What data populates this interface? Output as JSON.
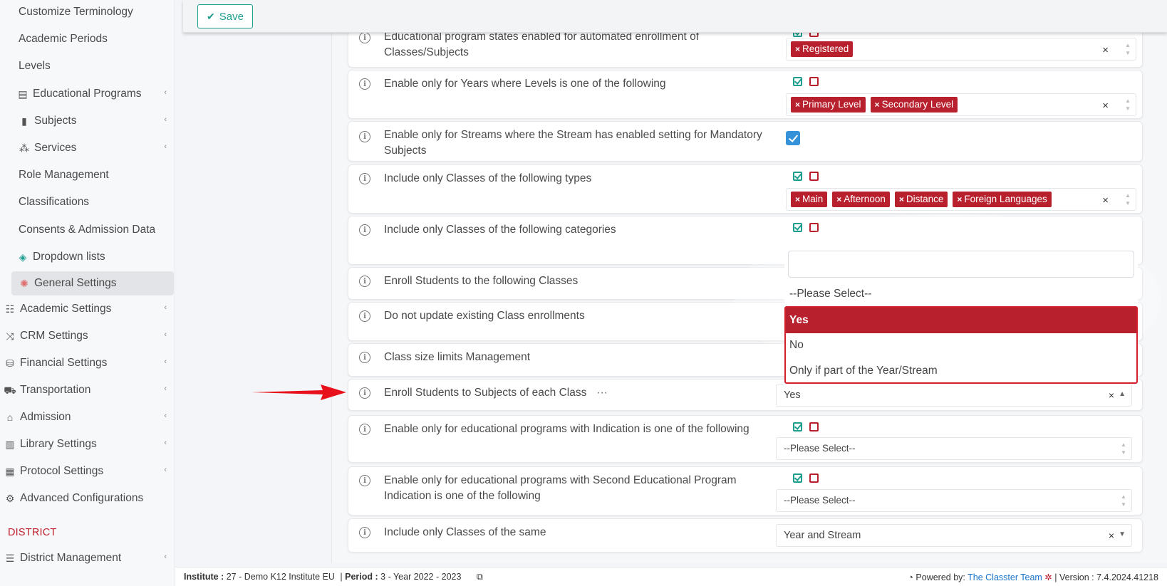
{
  "sidebar": {
    "items": [
      {
        "label": "Customize Terminology",
        "icon": "",
        "chevron": false
      },
      {
        "label": "Academic Periods",
        "icon": "",
        "chevron": false
      },
      {
        "label": "Levels",
        "icon": "",
        "chevron": false
      },
      {
        "label": "Educational Programs",
        "icon": "programs-icon",
        "chevron": true
      },
      {
        "label": "Subjects",
        "icon": "book-icon",
        "chevron": true
      },
      {
        "label": "Services",
        "icon": "services-icon",
        "chevron": true
      },
      {
        "label": "Role Management",
        "icon": "",
        "chevron": false
      },
      {
        "label": "Classifications",
        "icon": "",
        "chevron": false
      },
      {
        "label": "Consents & Admission Data",
        "icon": "",
        "chevron": false
      },
      {
        "label": "Dropdown lists",
        "icon": "layers-icon",
        "chevron": false
      },
      {
        "label": "General Settings",
        "icon": "gears-icon",
        "chevron": false,
        "active": true
      },
      {
        "label": "Academic Settings",
        "icon": "users-icon",
        "chevron": true
      },
      {
        "label": "CRM Settings",
        "icon": "crm-icon",
        "chevron": true
      },
      {
        "label": "Financial Settings",
        "icon": "coins-icon",
        "chevron": true
      },
      {
        "label": "Transportation",
        "icon": "bus-icon",
        "chevron": true
      },
      {
        "label": "Admission",
        "icon": "institution-icon",
        "chevron": true
      },
      {
        "label": "Library Settings",
        "icon": "library-icon",
        "chevron": true
      },
      {
        "label": "Protocol Settings",
        "icon": "protocol-icon",
        "chevron": true
      },
      {
        "label": "Advanced Configurations",
        "icon": "cogs-icon",
        "chevron": false
      }
    ],
    "district_header": "DISTRICT",
    "district_item": "District Management"
  },
  "toolbar": {
    "save_label": "Save"
  },
  "rows": {
    "r0": {
      "label": "Educational program states enabled for automated enrollment of Classes/Subjects",
      "tags": [
        "Registered"
      ]
    },
    "r1": {
      "label": "Enable only for Years where Levels is one of the following",
      "tags": [
        "Primary Level",
        "Secondary Level"
      ]
    },
    "r2": {
      "label": "Enable only for Streams where the Stream has enabled setting for Mandatory Subjects"
    },
    "r3": {
      "label": "Include only Classes of the following types",
      "tags": [
        "Main",
        "Afternoon",
        "Distance",
        "Foreign Languages"
      ]
    },
    "r4": {
      "label": "Include only Classes of the following categories"
    },
    "r5": {
      "label": "Enroll Students to the following Classes"
    },
    "r6": {
      "label": "Do not update existing Class enrollments"
    },
    "r7": {
      "label": "Class size limits Management"
    },
    "r8": {
      "label": "Enroll Students to Subjects of each Class",
      "more": "···",
      "value": "Yes"
    },
    "r9": {
      "label": "Enable only for educational programs with Indication is one of the following",
      "placeholder": "--Please Select--"
    },
    "r10": {
      "label": "Enable only for educational programs with Second Educational Program Indication is one of the following",
      "placeholder": "--Please Select--"
    },
    "r11": {
      "label": "Include only Classes of the same",
      "value": "Year and Stream"
    }
  },
  "dropdown": {
    "search_value": "",
    "options": [
      "--Please Select--",
      "Yes",
      "No",
      "Only if part of the Year/Stream"
    ],
    "selected": "Yes"
  },
  "footer": {
    "institute_label": "Institute :",
    "institute_value": "27 - Demo K12 Institute EU",
    "period_label": "Period :",
    "period_value": "3 - Year 2022 - 2023",
    "powered_label": "Powered by:",
    "powered_link": "The Classter Team",
    "version_label": "| Version :",
    "version_value": "7.4.2024.41218"
  },
  "colors": {
    "accent": "#1e9e8f",
    "brand_red": "#b8202e",
    "checkbox_blue": "#3592d8",
    "highlight_red": "#d2202e"
  }
}
